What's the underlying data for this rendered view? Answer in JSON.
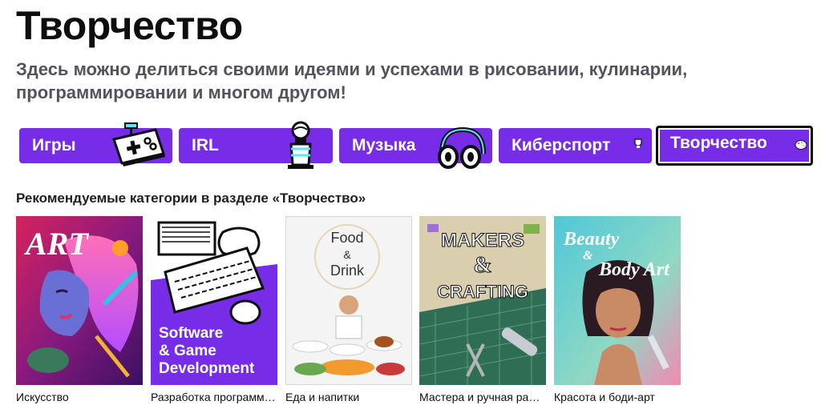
{
  "page": {
    "title": "Творчество",
    "description": "Здесь можно делиться своими идеями и успехами в рисовании, кулинарии, программировании и многом другом!"
  },
  "tabs": [
    {
      "label": "Игры",
      "icon": "gamepad-icon",
      "active": false
    },
    {
      "label": "IRL",
      "icon": "microphone-icon",
      "active": false
    },
    {
      "label": "Музыка",
      "icon": "headphones-icon",
      "active": false
    },
    {
      "label": "Киберспорт",
      "icon": "trophy-icon",
      "active": false
    },
    {
      "label": "Творчество",
      "icon": "palette-icon",
      "active": true
    }
  ],
  "section": {
    "heading": "Рекомендуемые категории в разделе «Творчество»"
  },
  "categories": [
    {
      "title": "Искусство",
      "cover_text": "ART"
    },
    {
      "title": "Разработка программ и игр",
      "cover_text_1": "Software",
      "cover_text_2": "& Game",
      "cover_text_3": "Development"
    },
    {
      "title": "Еда и напитки",
      "cover_text_1": "Food",
      "cover_text_2": "&",
      "cover_text_3": "Drink"
    },
    {
      "title": "Мастера и ручная работа",
      "cover_text_1": "MAKERS",
      "cover_text_2": "&",
      "cover_text_3": "CRAFTING"
    },
    {
      "title": "Красота и боди-арт",
      "cover_text_1": "Beauty",
      "cover_text_2": "&",
      "cover_text_3": "Body Art"
    }
  ],
  "colors": {
    "accent": "#772ce8",
    "title": "#0e0e10",
    "description": "#53535f"
  }
}
